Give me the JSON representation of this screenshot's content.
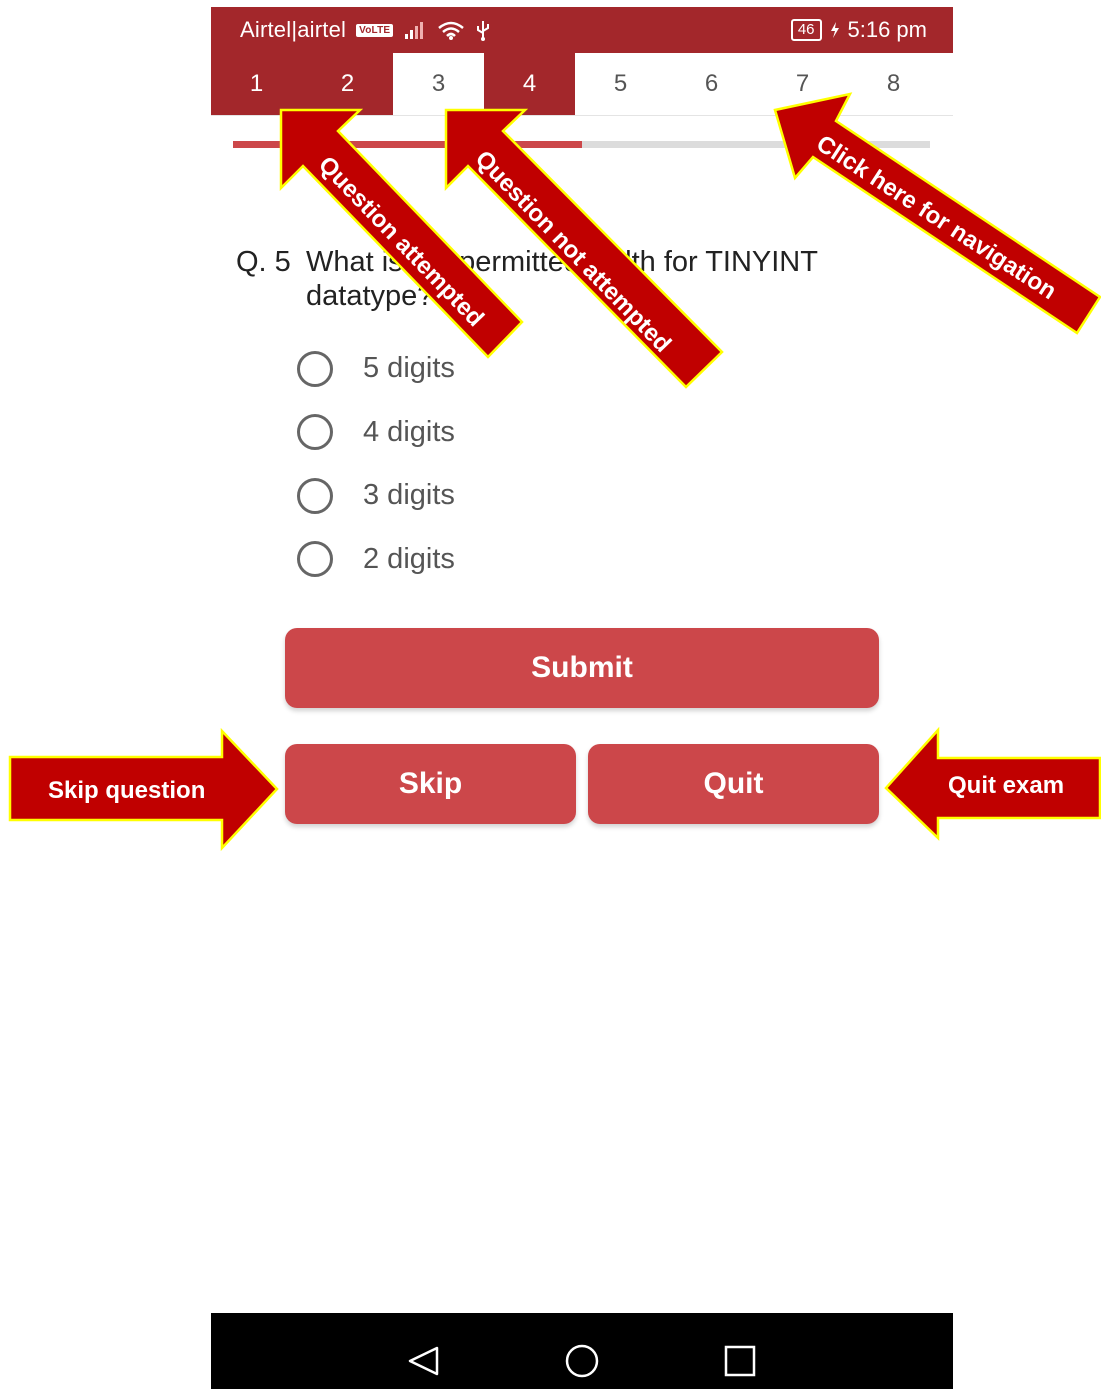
{
  "status_bar": {
    "carrier": "Airtel|airtel",
    "volte": "VoLTE",
    "battery": "46",
    "time": "5:16 pm"
  },
  "tabs": [
    {
      "label": "1",
      "state": "attempted"
    },
    {
      "label": "2",
      "state": "attempted"
    },
    {
      "label": "3",
      "state": "current"
    },
    {
      "label": "4",
      "state": "attempted"
    },
    {
      "label": "5",
      "state": "not-attempted"
    },
    {
      "label": "6",
      "state": "not-attempted"
    },
    {
      "label": "7",
      "state": "not-attempted"
    },
    {
      "label": "8",
      "state": "not-attempted"
    }
  ],
  "progress": {
    "fraction": 0.5
  },
  "question": {
    "number": "Q. 5",
    "text": "What is the permitted width for TINYINT datatype?"
  },
  "options": [
    "5 digits",
    "4 digits",
    "3 digits",
    "2 digits"
  ],
  "buttons": {
    "submit": "Submit",
    "skip": "Skip",
    "quit": "Quit"
  },
  "annotations": {
    "question_attempted": "Question attempted",
    "question_not_attempted": "Question not attempted",
    "navigation": "Click here for navigation",
    "skip_question": "Skip question",
    "quit_exam": "Quit exam"
  },
  "colors": {
    "primary_dark": "#a3272b",
    "primary": "#cc474a",
    "annotation_fill": "#c00000",
    "annotation_stroke": "#ffff00"
  }
}
